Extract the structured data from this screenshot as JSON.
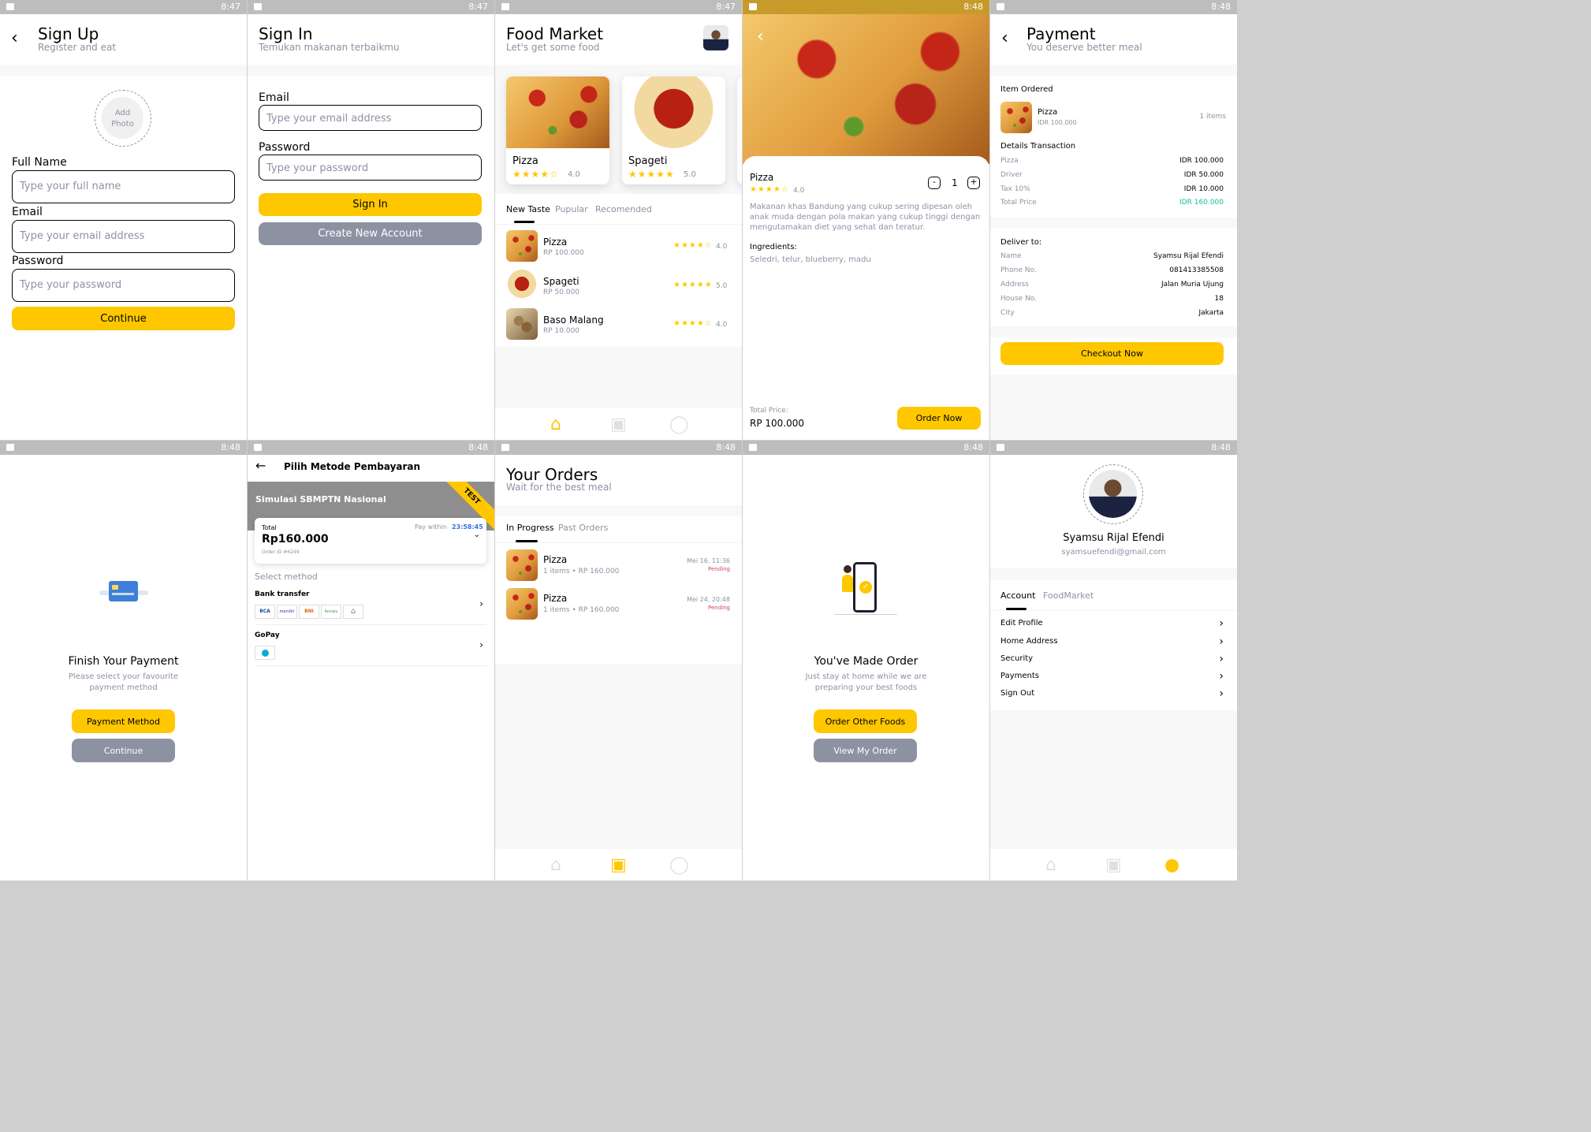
{
  "status_times": [
    "8:47",
    "8:47",
    "8:47",
    "8:48",
    "8:48",
    "8:48",
    "8:48",
    "8:48",
    "8:48",
    "8:48"
  ],
  "signup": {
    "title": "Sign Up",
    "subtitle": "Register and eat",
    "photo_line1": "Add",
    "photo_line2": "Photo",
    "fullname_label": "Full Name",
    "fullname_placeholder": "Type your full name",
    "email_label": "Email",
    "email_placeholder": "Type your email address",
    "password_label": "Password",
    "password_placeholder": "Type your password",
    "continue": "Continue"
  },
  "signin": {
    "title": "Sign In",
    "subtitle": "Temukan makanan terbaikmu",
    "email_label": "Email",
    "email_placeholder": "Type your email address",
    "password_label": "Password",
    "password_placeholder": "Type your password",
    "signin": "Sign In",
    "create": "Create New Account"
  },
  "home": {
    "title": "Food Market",
    "subtitle": "Let's get some food",
    "featured": [
      {
        "name": "Pizza",
        "stars": "★★★★☆",
        "rating": "4.0"
      },
      {
        "name": "Spageti",
        "stars": "★★★★★",
        "rating": "5.0"
      }
    ],
    "tabs": [
      "New Taste",
      "Pupular",
      "Recomended"
    ],
    "items": [
      {
        "name": "Pizza",
        "price": "RP 100.000",
        "stars": "★★★★☆",
        "rating": "4.0"
      },
      {
        "name": "Spageti",
        "price": "RP 50.000",
        "stars": "★★★★★",
        "rating": "5.0"
      },
      {
        "name": "Baso Malang",
        "price": "RP 10.000",
        "stars": "★★★★☆",
        "rating": "4.0"
      }
    ]
  },
  "detail": {
    "name": "Pizza",
    "stars": "★★★★☆",
    "rating": "4.0",
    "qty": "1",
    "minus": "-",
    "plus": "+",
    "description": "Makanan khas Bandung yang cukup sering dipesan oleh anak muda dengan pola makan yang cukup tinggi dengan mengutamakan diet yang sehat dan teratur.",
    "ingredients_label": "Ingredients:",
    "ingredients": "Seledri, telur, blueberry, madu",
    "total_label": "Total Price:",
    "total": "RP 100.000",
    "order": "Order Now"
  },
  "payment": {
    "title": "Payment",
    "subtitle": "You deserve better meal",
    "item_ordered": "Item Ordered",
    "item_name": "Pizza",
    "item_price": "IDR 100.000",
    "item_count": "1 items",
    "details": "Details Transaction",
    "rows": [
      {
        "label": "Pizza",
        "value": "IDR 100.000"
      },
      {
        "label": "Driver",
        "value": "IDR 50.000"
      },
      {
        "label": "Tax 10%",
        "value": "IDR 10.000"
      },
      {
        "label": "Total Price",
        "value": "IDR 160.000"
      }
    ],
    "deliver": "Deliver to:",
    "deliver_rows": [
      {
        "label": "Name",
        "value": "Syamsu Rijal Efendi"
      },
      {
        "label": "Phone No.",
        "value": "081413385508"
      },
      {
        "label": "Address",
        "value": "Jalan Muria Ujung"
      },
      {
        "label": "House No.",
        "value": "18"
      },
      {
        "label": "City",
        "value": "Jakarta"
      }
    ],
    "checkout": "Checkout Now",
    "total_color": "#1abc9c"
  },
  "finish": {
    "title": "Finish Your Payment",
    "line1": "Please select your favourite",
    "line2": "payment method",
    "method": "Payment Method",
    "continue": "Continue"
  },
  "metode": {
    "title": "Pilih Metode Pembayaran",
    "banner": "Simulasi SBMPTN Nasional",
    "ribbon": "TEST",
    "total_label": "Total",
    "pay_within": "Pay within",
    "countdown": "23:58:45",
    "amount": "Rp160.000",
    "order_id": "Order ID #6249",
    "select": "Select method",
    "bank": "Bank transfer",
    "banks": [
      "BCA",
      "mandiri",
      "BNI",
      "Permata"
    ],
    "gopay": "GoPay"
  },
  "orders": {
    "title": "Your Orders",
    "subtitle": "Wait for the best meal",
    "tabs": [
      "In Progress",
      "Past Orders"
    ],
    "items": [
      {
        "name": "Pizza",
        "info": "1 items • RP 160.000",
        "date": "Mei 16, 11:36",
        "status": "Pending"
      },
      {
        "name": "Pizza",
        "info": "1 items • RP 160.000",
        "date": "Mei 24, 20:48",
        "status": "Pending"
      }
    ]
  },
  "success": {
    "title": "You've Made Order",
    "line1": "Just stay at home while we are",
    "line2": "preparing your best foods",
    "other": "Order Other Foods",
    "view": "View My Order"
  },
  "profile": {
    "name": "Syamsu Rijal Efendi",
    "email": "syamsuefendi@gmail.com",
    "tabs": [
      "Account",
      "FoodMarket"
    ],
    "menu": [
      "Edit Profile",
      "Home Address",
      "Security",
      "Payments",
      "Sign Out"
    ]
  }
}
